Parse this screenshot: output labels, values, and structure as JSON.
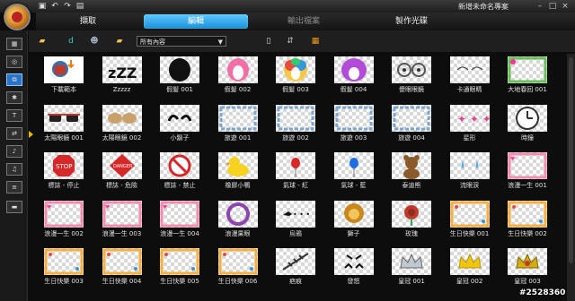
{
  "window": {
    "project_title": "新增未命名專案"
  },
  "tabs": [
    {
      "label": "擷取",
      "state": "normal"
    },
    {
      "label": "編輯",
      "state": "active"
    },
    {
      "label": "輸出檔案",
      "state": "dim"
    },
    {
      "label": "製作光碟",
      "state": "normal"
    }
  ],
  "filter": {
    "selected": "所有內容"
  },
  "items": [
    {
      "label": "下載範本",
      "icon": "download-templates"
    },
    {
      "label": "Zzzzz",
      "icon": "zzz"
    },
    {
      "label": "假髮 001",
      "icon": "wig-black"
    },
    {
      "label": "假髮 002",
      "icon": "wig-pink"
    },
    {
      "label": "假髮 003",
      "icon": "wig-rainbow"
    },
    {
      "label": "假髮 004",
      "icon": "wig-purple"
    },
    {
      "label": "傻眼眼鏡",
      "icon": "goofy-glasses"
    },
    {
      "label": "卡通眼睛",
      "icon": "cartoon-eyes"
    },
    {
      "label": "大地春回 001",
      "icon": "spring-frame"
    },
    {
      "label": "太陽眼鏡 001",
      "icon": "sunglasses-red"
    },
    {
      "label": "太陽眼鏡 002",
      "icon": "sunglasses-tan"
    },
    {
      "label": "小鬍子",
      "icon": "mustache"
    },
    {
      "label": "旅遊 001",
      "icon": "travel-frame"
    },
    {
      "label": "旅遊 002",
      "icon": "travel-frame"
    },
    {
      "label": "旅遊 003",
      "icon": "travel-frame"
    },
    {
      "label": "旅遊 004",
      "icon": "travel-frame"
    },
    {
      "label": "星形",
      "icon": "stars"
    },
    {
      "label": "時鐘",
      "icon": "clock"
    },
    {
      "label": "標誌 - 停止",
      "icon": "stop-sign"
    },
    {
      "label": "標誌 - 危險",
      "icon": "danger-sign"
    },
    {
      "label": "標誌 - 禁止",
      "icon": "no-sign"
    },
    {
      "label": "橡膠小鴨",
      "icon": "rubber-duck"
    },
    {
      "label": "氣球 - 紅",
      "icon": "balloon-red"
    },
    {
      "label": "氣球 - 藍",
      "icon": "balloon-blue"
    },
    {
      "label": "泰迪熊",
      "icon": "teddy-bear"
    },
    {
      "label": "流眼淚",
      "icon": "tears"
    },
    {
      "label": "浪漫一生 001",
      "icon": "romance-frame"
    },
    {
      "label": "浪漫一生 002",
      "icon": "romance-frame"
    },
    {
      "label": "浪漫一生 003",
      "icon": "romance-frame"
    },
    {
      "label": "浪漫一生 004",
      "icon": "romance-frame"
    },
    {
      "label": "浪漫果眼",
      "icon": "purple-ring"
    },
    {
      "label": "烏鴉",
      "icon": "crow"
    },
    {
      "label": "獅子",
      "icon": "lion"
    },
    {
      "label": "玫瑰",
      "icon": "rose"
    },
    {
      "label": "生日快樂 001",
      "icon": "birthday-frame"
    },
    {
      "label": "生日快樂 002",
      "icon": "birthday-frame"
    },
    {
      "label": "生日快樂 003",
      "icon": "birthday-frame"
    },
    {
      "label": "生日快樂 004",
      "icon": "birthday-frame"
    },
    {
      "label": "生日快樂 005",
      "icon": "birthday-frame"
    },
    {
      "label": "生日快樂 006",
      "icon": "birthday-frame"
    },
    {
      "label": "疤痕",
      "icon": "scar"
    },
    {
      "label": "發怒",
      "icon": "angry-face"
    },
    {
      "label": "皇冠 001",
      "icon": "crown-silver"
    },
    {
      "label": "皇冠 002",
      "icon": "crown-gold"
    },
    {
      "label": "皇冠 003",
      "icon": "crown-jewel"
    }
  ],
  "watermark": "#2528360"
}
